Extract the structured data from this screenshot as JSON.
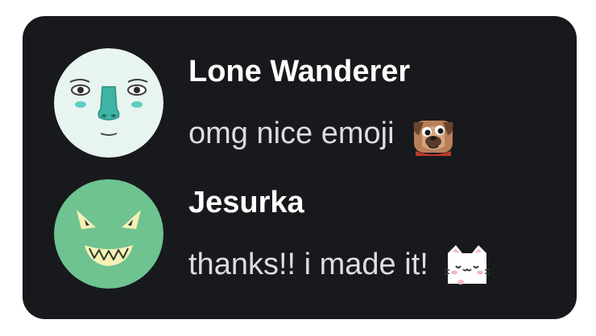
{
  "messages": [
    {
      "username": "Lone Wanderer",
      "text": "omg nice emoji",
      "avatar_icon": "pale-face-avatar",
      "emoji_icon": "pug-emoji-icon",
      "avatar_color": "#e8f4ef"
    },
    {
      "username": "Jesurka",
      "text": "thanks!! i made it!",
      "avatar_icon": "grinning-creature-avatar",
      "emoji_icon": "uwu-cat-emoji-icon",
      "avatar_color": "#6ec391"
    }
  ],
  "colors": {
    "card_background": "#18191c",
    "username": "#ffffff",
    "message_text": "#dcddde"
  }
}
